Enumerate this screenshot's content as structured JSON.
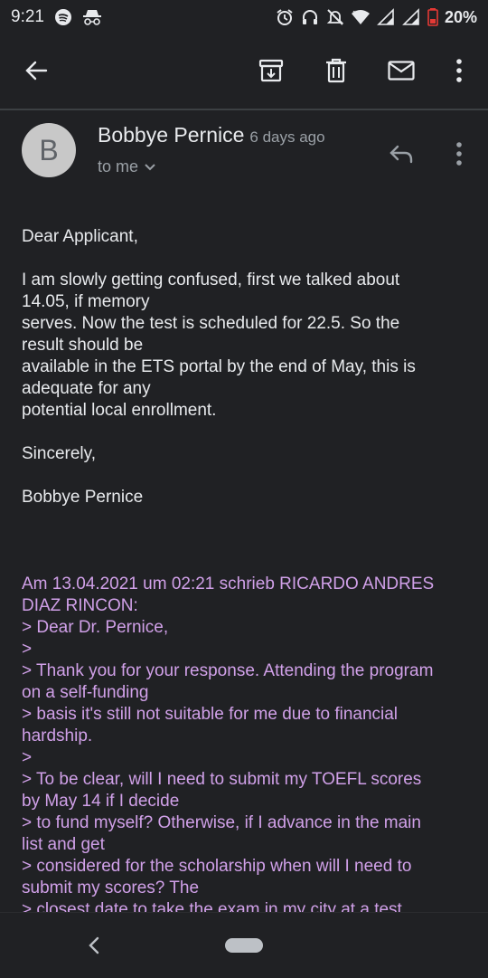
{
  "status_bar": {
    "time": "9:21",
    "battery": "20%",
    "left_icons": [
      "spotify-icon",
      "incognito-icon"
    ],
    "right_icons": [
      "alarm-icon",
      "headset-icon",
      "notifications-off-icon",
      "wifi-icon",
      "signal-icon",
      "signal-icon-2",
      "battery-icon"
    ]
  },
  "toolbar": {
    "actions": [
      "back",
      "archive",
      "delete",
      "mark-unread",
      "more"
    ]
  },
  "email": {
    "avatar_letter": "B",
    "sender": "Bobbye Pernice",
    "time": "6 days ago",
    "recipient": "to me",
    "greeting": "Dear Applicant,",
    "paragraph": [
      "I am slowly getting confused, first we talked about",
      "14.05, if memory",
      "serves. Now the test is scheduled for 22.5. So the",
      "result should be",
      "available in the ETS portal by the end of May, this is",
      "adequate for any",
      "potential local enrollment."
    ],
    "closing": "Sincerely,",
    "signature": "Bobbye Pernice",
    "quoted": [
      "Am 13.04.2021 um 02:21 schrieb RICARDO ANDRES",
      "DIAZ RINCON:",
      "> Dear Dr. Pernice,",
      ">",
      "> Thank you for your response. Attending the program",
      "on a self-funding",
      "> basis it's still not suitable for me due to financial",
      "hardship.",
      ">",
      "> To be clear, will I need to submit my TOEFL scores",
      "by May 14 if I decide",
      "> to fund myself? Otherwise, if I advance in the main",
      "list and get",
      "> considered for the scholarship when will I need to",
      "submit my scores? The",
      "> closest date to take the exam in my city at a test"
    ]
  },
  "colors": {
    "background": "#202124",
    "text": "#e8eaed",
    "secondary": "#9aa0a6",
    "quoted": "#d0a0e8"
  }
}
